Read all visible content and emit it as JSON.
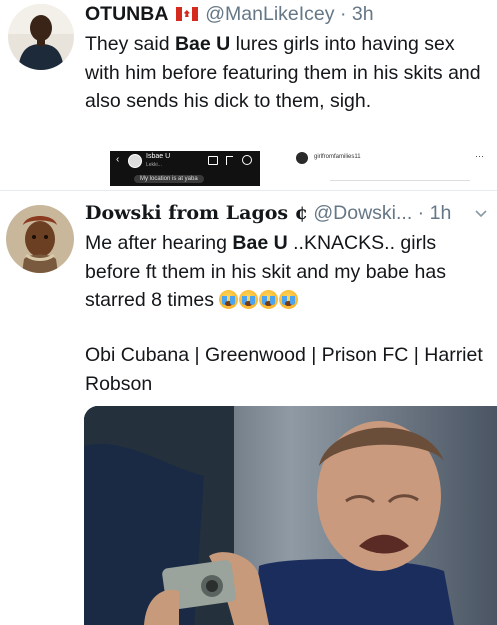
{
  "tweets": [
    {
      "display_name": "OTUNBA",
      "handle": "@ManLikeIcey",
      "dot": "·",
      "time": "3h",
      "text_parts": [
        "They said ",
        "Bae U",
        " lures girls into having sex with him before featuring them in his skits and also sends his dick to them, sigh."
      ],
      "embedded_left": {
        "username": "Isbae U",
        "sub": "Lekki...",
        "bubble": "My location is at yaba"
      },
      "embedded_right": {
        "username": "girlfromfamilies11"
      }
    },
    {
      "display_name": "Dowski from Lagos ¢",
      "handle": "@Dowski...",
      "dot": "·",
      "time": "1h",
      "text_parts": [
        "Me after hearing ",
        "Bae U",
        " ..KNACKS.. girls before ft them in his skit and my babe has starred 8 times "
      ],
      "emoji_name": "crying-face-emoji",
      "emoji_count": 4,
      "tags_line": "Obi Cubana | Greenwood | Prison FC | Harriet Robson",
      "media_description_hidden": ""
    }
  ],
  "colors": {
    "text": "#14171a",
    "muted": "#657786",
    "divider": "#e6ecf0"
  }
}
